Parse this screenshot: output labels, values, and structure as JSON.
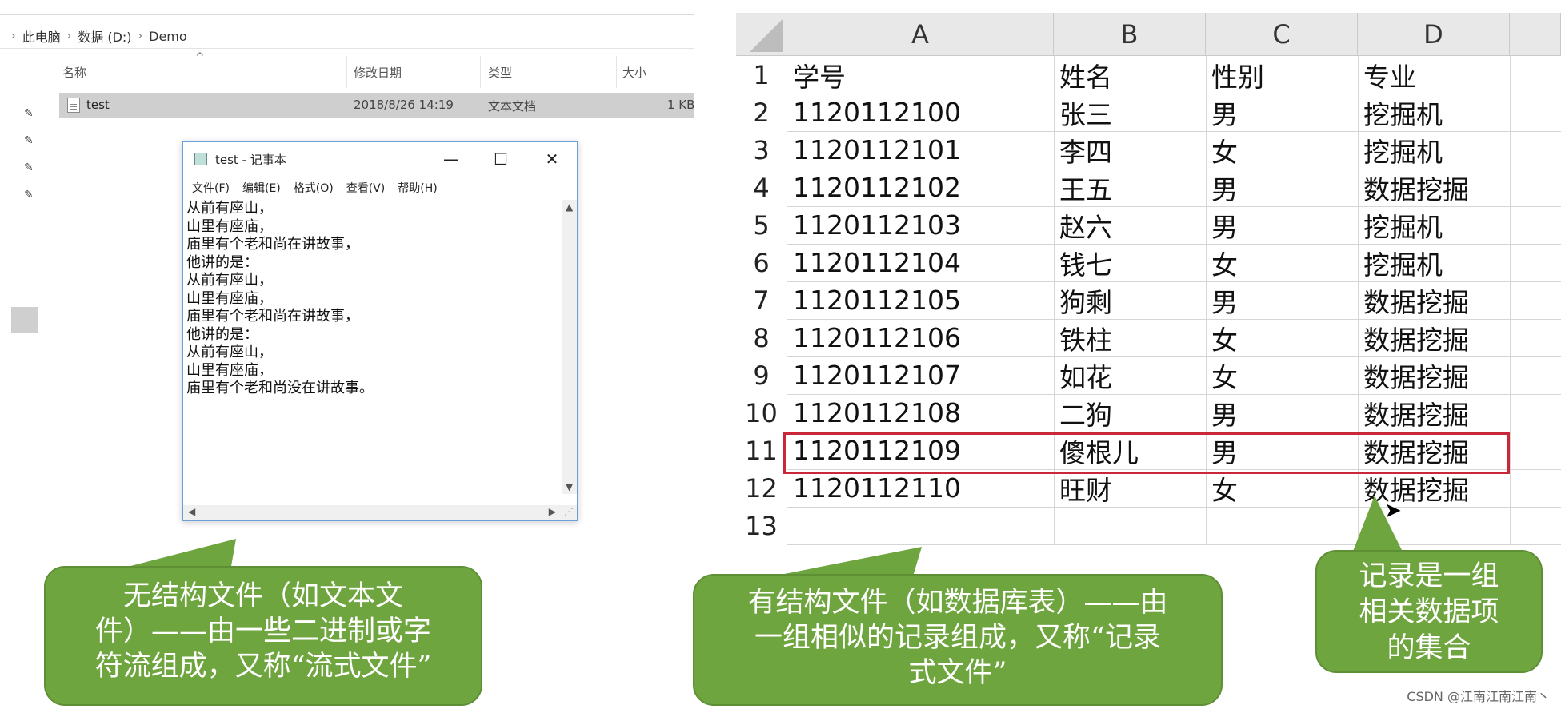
{
  "explorer": {
    "breadcrumb": [
      "此电脑",
      "数据 (D:)",
      "Demo"
    ],
    "columns": {
      "name": "名称",
      "modified": "修改日期",
      "type": "类型",
      "size": "大小"
    },
    "file": {
      "name": "test",
      "modified": "2018/8/26 14:19",
      "type": "文本文档",
      "size": "1 KB"
    }
  },
  "notepad": {
    "title": "test - 记事本",
    "menus": [
      "文件(F)",
      "编辑(E)",
      "格式(O)",
      "查看(V)",
      "帮助(H)"
    ],
    "lines": [
      "从前有座山，",
      "山里有座庙，",
      "庙里有个老和尚在讲故事，",
      "他讲的是：",
      "从前有座山，",
      "山里有座庙，",
      "庙里有个老和尚在讲故事，",
      "他讲的是：",
      "从前有座山，",
      "山里有座庙，",
      "庙里有个老和尚没在讲故事。"
    ]
  },
  "sheet": {
    "columns": [
      "A",
      "B",
      "C",
      "D"
    ],
    "row_numbers": [
      "1",
      "2",
      "3",
      "4",
      "5",
      "6",
      "7",
      "8",
      "9",
      "10",
      "11",
      "12",
      "13"
    ],
    "rows": [
      [
        "学号",
        "姓名",
        "性别",
        "专业"
      ],
      [
        "1120112100",
        "张三",
        "男",
        "挖掘机"
      ],
      [
        "1120112101",
        "李四",
        "女",
        "挖掘机"
      ],
      [
        "1120112102",
        "王五",
        "男",
        "数据挖掘"
      ],
      [
        "1120112103",
        "赵六",
        "男",
        "挖掘机"
      ],
      [
        "1120112104",
        "钱七",
        "女",
        "挖掘机"
      ],
      [
        "1120112105",
        "狗剩",
        "男",
        "数据挖掘"
      ],
      [
        "1120112106",
        "铁柱",
        "女",
        "数据挖掘"
      ],
      [
        "1120112107",
        "如花",
        "女",
        "数据挖掘"
      ],
      [
        "1120112108",
        "二狗",
        "男",
        "数据挖掘"
      ],
      [
        "1120112109",
        "傻根儿",
        "男",
        "数据挖掘"
      ],
      [
        "1120112110",
        "旺财",
        "女",
        "数据挖掘"
      ],
      [
        "",
        "",
        "",
        ""
      ]
    ],
    "highlight_color": "#c8283a"
  },
  "callouts": {
    "left": [
      "无结构文件（如文本文",
      "件）——由一些二进制或字",
      "符流组成，又称“流式文件”"
    ],
    "middle": [
      "有结构文件（如数据库表）——由",
      "一组相似的记录组成，又称“记录",
      "式文件”"
    ],
    "right": [
      "记录是一组",
      "相关数据项",
      "的集合"
    ],
    "color": "#6fa53f"
  },
  "watermark": "CSDN @江南江南江南丶"
}
